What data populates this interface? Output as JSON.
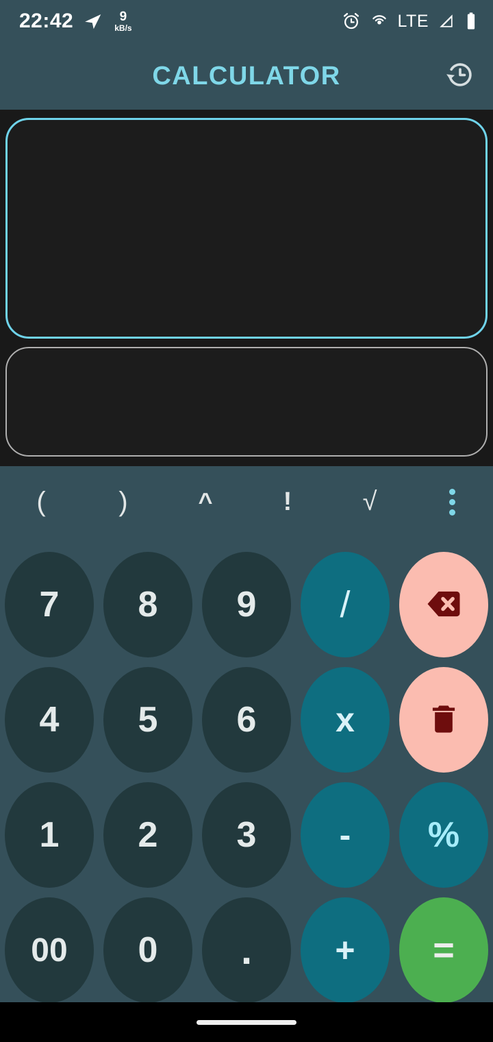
{
  "status_bar": {
    "time": "22:42",
    "network_speed_value": "9",
    "network_speed_unit": "kB/s",
    "lte_label": "LTE",
    "icons": {
      "send": "send-icon",
      "alarm": "alarm-icon",
      "hotspot": "hotspot-icon",
      "signal": "signal-icon",
      "battery": "battery-icon"
    }
  },
  "app_bar": {
    "title": "CALCULATOR",
    "history_icon": "history-icon",
    "title_color": "#7FD7E8"
  },
  "display": {
    "expression": "",
    "expression_placeholder": "",
    "result": "",
    "result_placeholder": "",
    "expression_border_color": "#6FD3EA",
    "result_border_color": "#AFAFAF",
    "background": "#191919"
  },
  "function_row": {
    "keys": [
      {
        "label": "(",
        "name": "open-paren-key"
      },
      {
        "label": ")",
        "name": "close-paren-key"
      },
      {
        "label": "^",
        "name": "power-key"
      },
      {
        "label": "!",
        "name": "factorial-key"
      },
      {
        "label": "√",
        "name": "square-root-key"
      }
    ],
    "overflow_label": "more-options",
    "overflow_color": "#7FD7E8"
  },
  "keypad": {
    "colors": {
      "number": "#22393D",
      "operator": "#0E6E80",
      "action": "#FBBCB0",
      "action_glyph": "#6E0D0D",
      "equals": "#4CAF50"
    },
    "rows": [
      [
        {
          "label": "7",
          "type": "number",
          "name": "key-7"
        },
        {
          "label": "8",
          "type": "number",
          "name": "key-8"
        },
        {
          "label": "9",
          "type": "number",
          "name": "key-9"
        },
        {
          "label": "/",
          "type": "operator",
          "name": "key-divide"
        },
        {
          "label": "",
          "type": "icon",
          "icon": "backspace-icon",
          "name": "key-backspace"
        }
      ],
      [
        {
          "label": "4",
          "type": "number",
          "name": "key-4"
        },
        {
          "label": "5",
          "type": "number",
          "name": "key-5"
        },
        {
          "label": "6",
          "type": "number",
          "name": "key-6"
        },
        {
          "label": "x",
          "type": "operator",
          "name": "key-multiply"
        },
        {
          "label": "",
          "type": "icon",
          "icon": "trash-icon",
          "name": "key-clear-all"
        }
      ],
      [
        {
          "label": "1",
          "type": "number",
          "name": "key-1"
        },
        {
          "label": "2",
          "type": "number",
          "name": "key-2"
        },
        {
          "label": "3",
          "type": "number",
          "name": "key-3"
        },
        {
          "label": "-",
          "type": "operator",
          "name": "key-minus"
        },
        {
          "label": "%",
          "type": "operator",
          "name": "key-percent"
        }
      ],
      [
        {
          "label": "00",
          "type": "number",
          "name": "key-double-zero"
        },
        {
          "label": "0",
          "type": "number",
          "name": "key-0"
        },
        {
          "label": ".",
          "type": "number",
          "name": "key-decimal"
        },
        {
          "label": "+",
          "type": "operator",
          "name": "key-plus"
        },
        {
          "label": "=",
          "type": "equals",
          "name": "key-equals"
        }
      ]
    ]
  },
  "nav_bar": {
    "gesture_pill": "home-gesture-pill"
  }
}
